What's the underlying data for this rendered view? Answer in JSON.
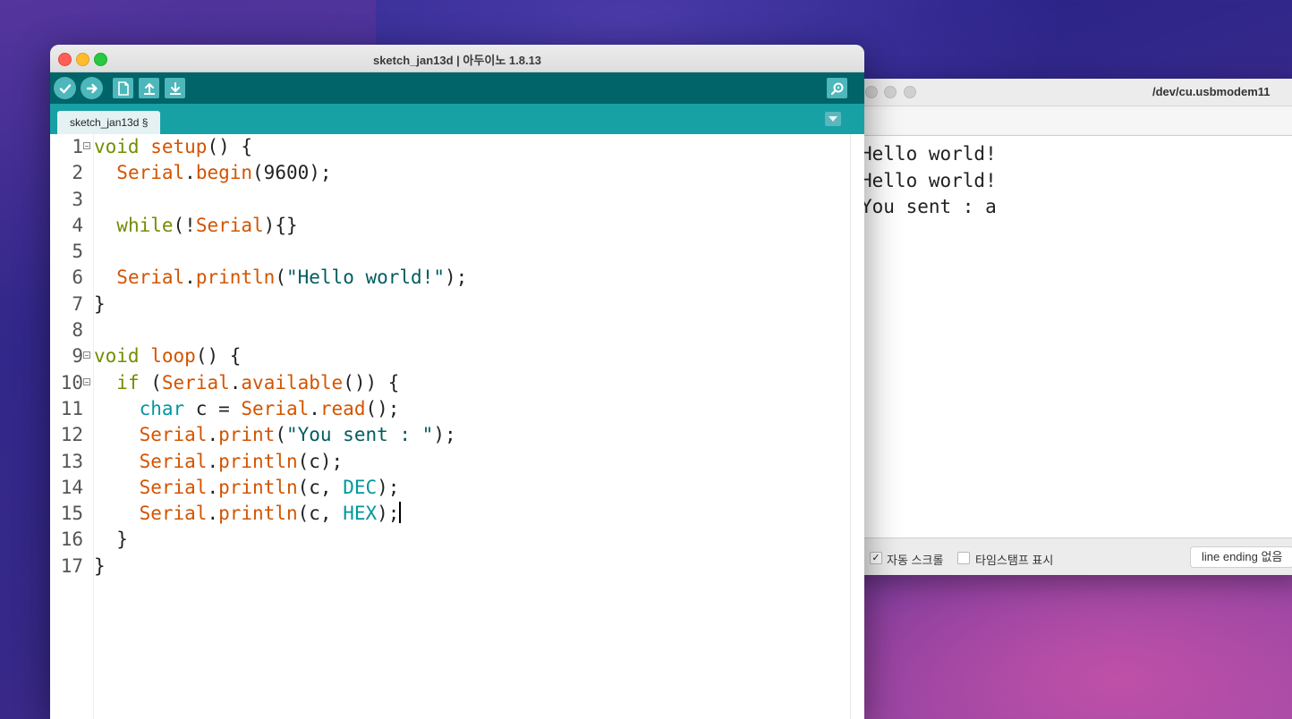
{
  "ide": {
    "title": "sketch_jan13d | 아두이노 1.8.13",
    "tab_label": "sketch_jan13d §",
    "toolbar": {
      "verify_icon": "check-icon",
      "upload_icon": "arrow-right-icon",
      "new_icon": "new-file-icon",
      "open_icon": "open-upload-icon",
      "save_icon": "save-download-icon",
      "serial_monitor_icon": "magnifier-icon"
    },
    "colors": {
      "toolbar": "#006468",
      "tabbar": "#17a1a5",
      "button": "#4db7bb",
      "keyword": "#728e00",
      "function": "#d35400",
      "string": "#005c5f",
      "constant": "#00979c"
    },
    "code_lines": [
      {
        "num": "1",
        "fold": true,
        "tokens": [
          {
            "t": "kw",
            "v": "void"
          },
          {
            "t": "",
            "v": " "
          },
          {
            "t": "fn",
            "v": "setup"
          },
          {
            "t": "",
            "v": "() {"
          }
        ]
      },
      {
        "num": "2",
        "fold": false,
        "tokens": [
          {
            "t": "",
            "v": "  "
          },
          {
            "t": "fn",
            "v": "Serial"
          },
          {
            "t": "",
            "v": "."
          },
          {
            "t": "fn",
            "v": "begin"
          },
          {
            "t": "",
            "v": "(9600);"
          }
        ]
      },
      {
        "num": "3",
        "fold": false,
        "tokens": []
      },
      {
        "num": "4",
        "fold": false,
        "tokens": [
          {
            "t": "",
            "v": "  "
          },
          {
            "t": "kw",
            "v": "while"
          },
          {
            "t": "",
            "v": "(!"
          },
          {
            "t": "fn",
            "v": "Serial"
          },
          {
            "t": "",
            "v": "){}"
          }
        ]
      },
      {
        "num": "5",
        "fold": false,
        "tokens": []
      },
      {
        "num": "6",
        "fold": false,
        "tokens": [
          {
            "t": "",
            "v": "  "
          },
          {
            "t": "fn",
            "v": "Serial"
          },
          {
            "t": "",
            "v": "."
          },
          {
            "t": "fn",
            "v": "println"
          },
          {
            "t": "",
            "v": "("
          },
          {
            "t": "str",
            "v": "\"Hello world!\""
          },
          {
            "t": "",
            "v": ");"
          }
        ]
      },
      {
        "num": "7",
        "fold": false,
        "tokens": [
          {
            "t": "",
            "v": "}"
          }
        ]
      },
      {
        "num": "8",
        "fold": false,
        "tokens": []
      },
      {
        "num": "9",
        "fold": true,
        "tokens": [
          {
            "t": "kw",
            "v": "void"
          },
          {
            "t": "",
            "v": " "
          },
          {
            "t": "fn",
            "v": "loop"
          },
          {
            "t": "",
            "v": "() {"
          }
        ]
      },
      {
        "num": "10",
        "fold": true,
        "tokens": [
          {
            "t": "",
            "v": "  "
          },
          {
            "t": "kw",
            "v": "if"
          },
          {
            "t": "",
            "v": " ("
          },
          {
            "t": "fn",
            "v": "Serial"
          },
          {
            "t": "",
            "v": "."
          },
          {
            "t": "fn",
            "v": "available"
          },
          {
            "t": "",
            "v": "()) {"
          }
        ]
      },
      {
        "num": "11",
        "fold": false,
        "tokens": [
          {
            "t": "",
            "v": "    "
          },
          {
            "t": "cst",
            "v": "char"
          },
          {
            "t": "",
            "v": " c = "
          },
          {
            "t": "fn",
            "v": "Serial"
          },
          {
            "t": "",
            "v": "."
          },
          {
            "t": "fn",
            "v": "read"
          },
          {
            "t": "",
            "v": "();"
          }
        ]
      },
      {
        "num": "12",
        "fold": false,
        "tokens": [
          {
            "t": "",
            "v": "    "
          },
          {
            "t": "fn",
            "v": "Serial"
          },
          {
            "t": "",
            "v": "."
          },
          {
            "t": "fn",
            "v": "print"
          },
          {
            "t": "",
            "v": "("
          },
          {
            "t": "str",
            "v": "\"You sent : \""
          },
          {
            "t": "",
            "v": ");"
          }
        ]
      },
      {
        "num": "13",
        "fold": false,
        "tokens": [
          {
            "t": "",
            "v": "    "
          },
          {
            "t": "fn",
            "v": "Serial"
          },
          {
            "t": "",
            "v": "."
          },
          {
            "t": "fn",
            "v": "println"
          },
          {
            "t": "",
            "v": "(c);"
          }
        ]
      },
      {
        "num": "14",
        "fold": false,
        "tokens": [
          {
            "t": "",
            "v": "    "
          },
          {
            "t": "fn",
            "v": "Serial"
          },
          {
            "t": "",
            "v": "."
          },
          {
            "t": "fn",
            "v": "println"
          },
          {
            "t": "",
            "v": "(c, "
          },
          {
            "t": "cst",
            "v": "DEC"
          },
          {
            "t": "",
            "v": ");"
          }
        ]
      },
      {
        "num": "15",
        "fold": false,
        "caret": true,
        "tokens": [
          {
            "t": "",
            "v": "    "
          },
          {
            "t": "fn",
            "v": "Serial"
          },
          {
            "t": "",
            "v": "."
          },
          {
            "t": "fn",
            "v": "println"
          },
          {
            "t": "",
            "v": "(c, "
          },
          {
            "t": "cst",
            "v": "HEX"
          },
          {
            "t": "",
            "v": ");"
          }
        ]
      },
      {
        "num": "16",
        "fold": false,
        "tokens": [
          {
            "t": "",
            "v": "  }"
          }
        ]
      },
      {
        "num": "17",
        "fold": false,
        "tokens": [
          {
            "t": "",
            "v": "}"
          }
        ]
      }
    ]
  },
  "serial": {
    "title": "/dev/cu.usbmodem11",
    "input_value": "",
    "output_lines": [
      "Hello world!",
      "Hello world!",
      "You sent : a"
    ],
    "autoscroll": {
      "label": "자동 스크롤",
      "checked": true
    },
    "timestamp": {
      "label": "타임스탬프 표시",
      "checked": false
    },
    "line_ending": "line ending 없음"
  }
}
